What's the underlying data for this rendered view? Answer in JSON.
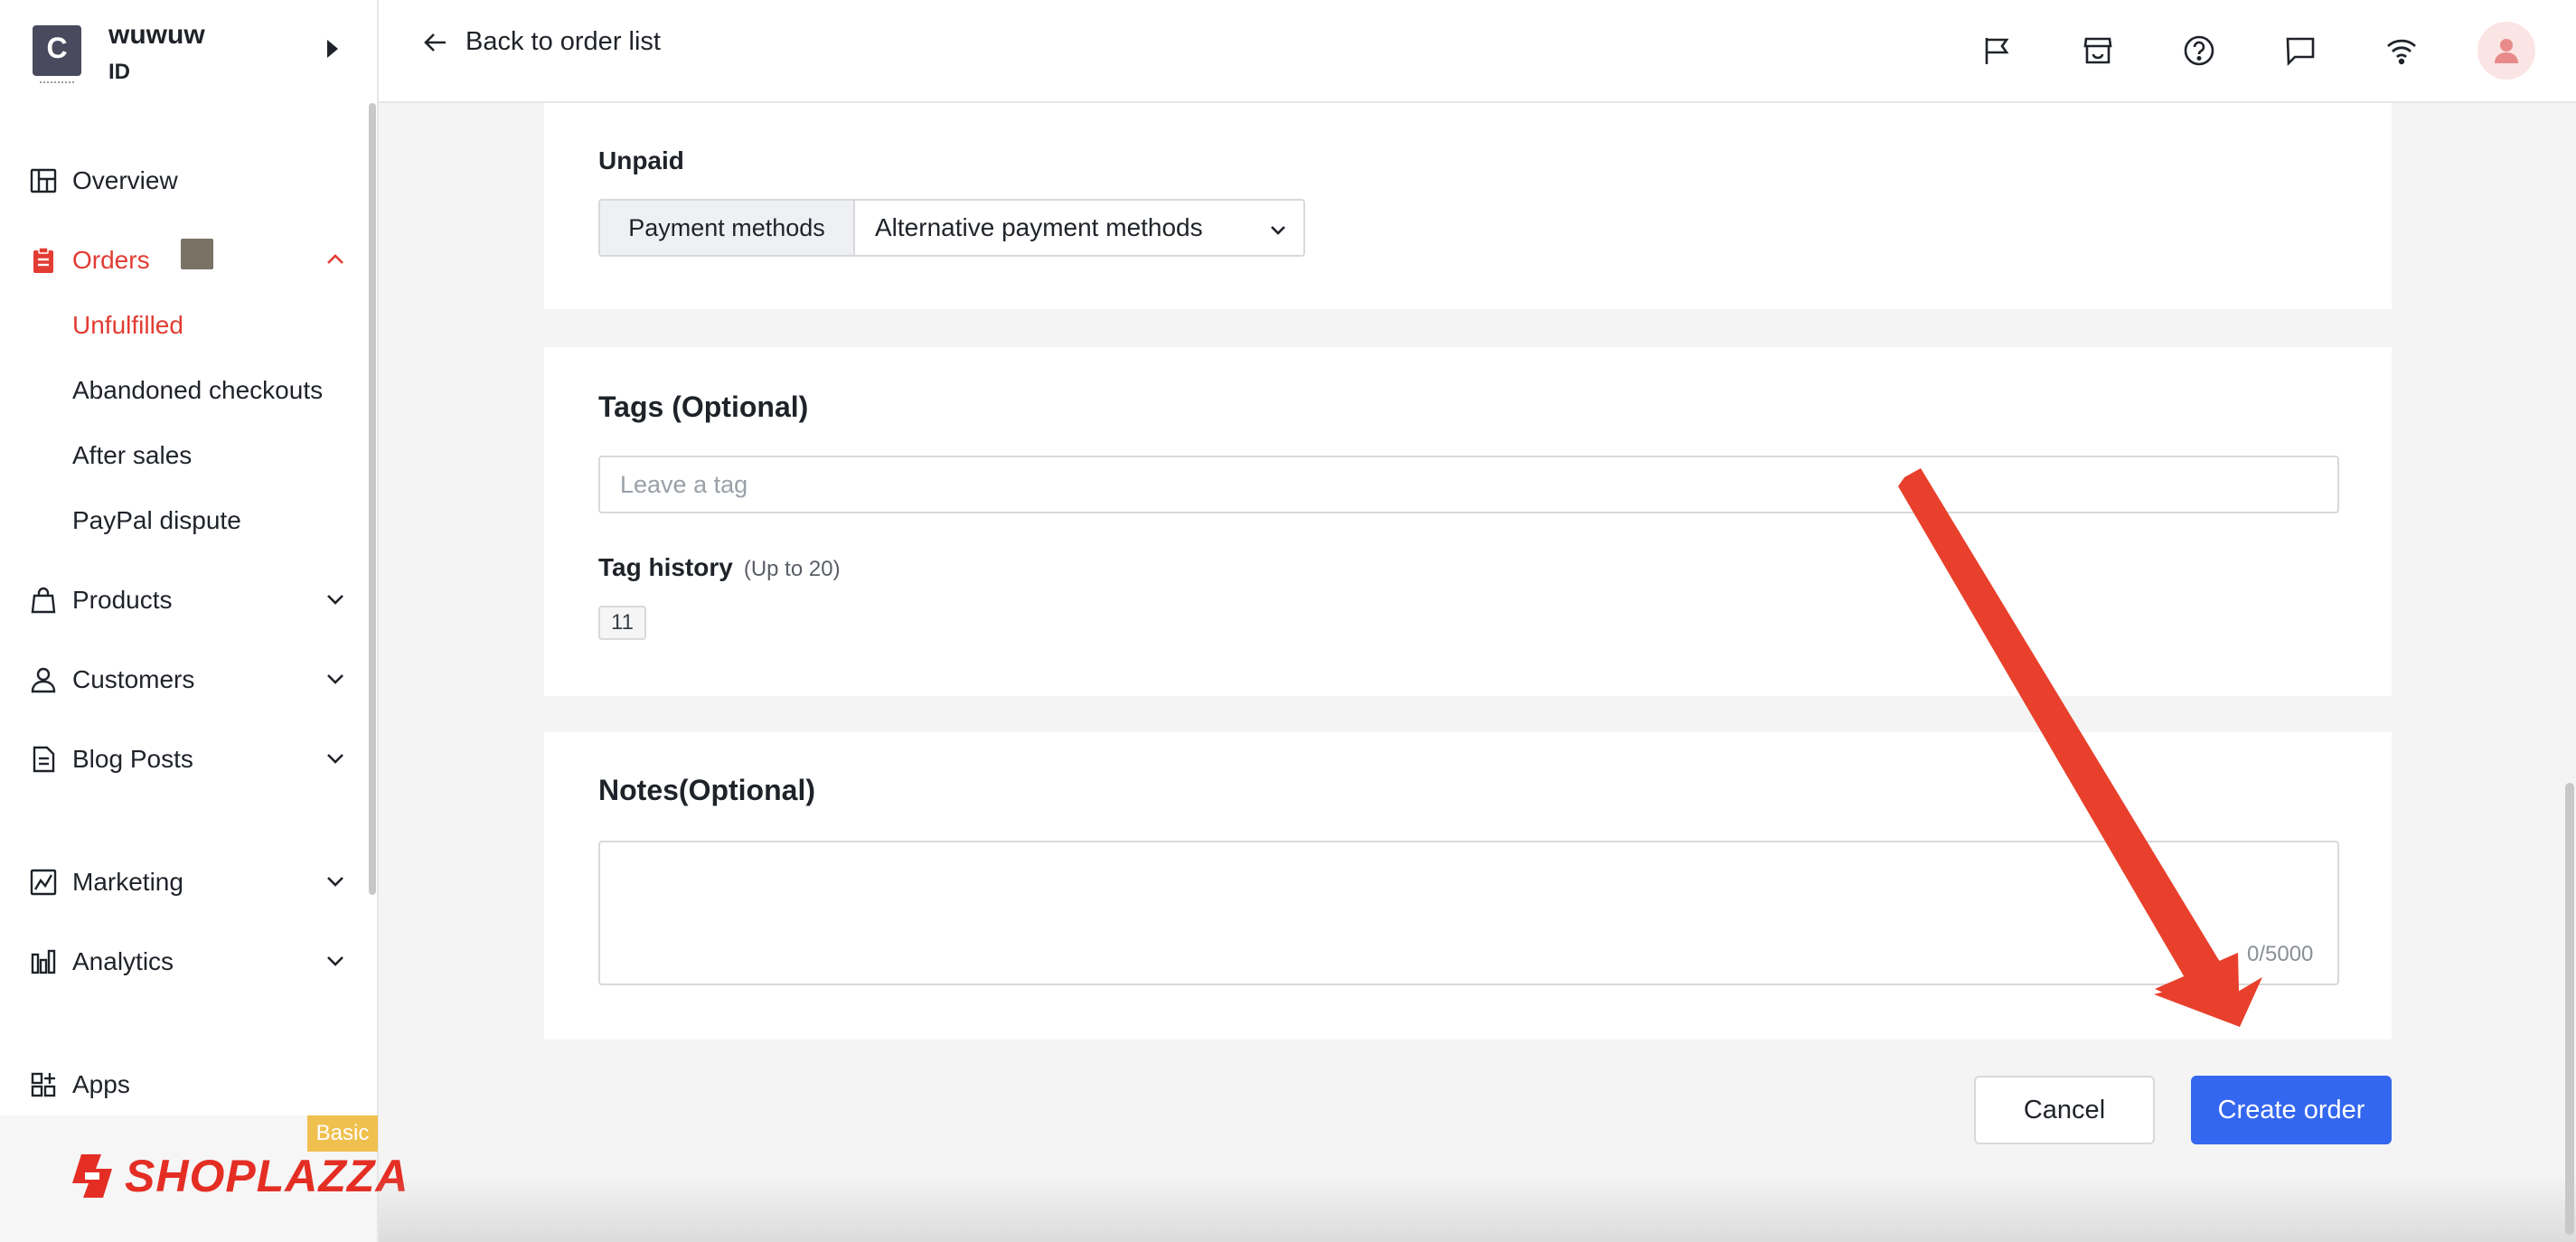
{
  "sidebar": {
    "store": {
      "logo_letter": "C",
      "name": "wuwuw",
      "id": "ID"
    },
    "items": [
      {
        "label": "Overview",
        "icon": "layout-icon"
      },
      {
        "label": "Orders",
        "icon": "clipboard-icon",
        "active": true,
        "expanded": true,
        "subitems": [
          {
            "label": "Unfulfilled",
            "active": true
          },
          {
            "label": "Abandoned checkouts"
          },
          {
            "label": "After sales"
          },
          {
            "label": "PayPal dispute"
          }
        ]
      },
      {
        "label": "Products",
        "icon": "bag-icon"
      },
      {
        "label": "Customers",
        "icon": "person-icon"
      },
      {
        "label": "Blog Posts",
        "icon": "document-icon"
      },
      {
        "label": "Marketing",
        "icon": "marketing-icon"
      },
      {
        "label": "Analytics",
        "icon": "bar-chart-icon"
      },
      {
        "label": "Apps",
        "icon": "apps-grid-icon"
      }
    ],
    "plan_badge": "Basic",
    "brand": "SHOPLAZZA"
  },
  "header": {
    "back_label": "Back to order list",
    "icons": [
      "flag-icon",
      "store-icon",
      "help-icon",
      "chat-icon",
      "wifi-icon",
      "avatar-icon"
    ]
  },
  "payment": {
    "status": "Unpaid",
    "addon_label": "Payment methods",
    "selected": "Alternative payment methods"
  },
  "tags": {
    "title": "Tags (Optional)",
    "placeholder": "Leave a tag",
    "history_title": "Tag history",
    "history_hint": "(Up to 20)",
    "history_items": [
      "11"
    ]
  },
  "notes": {
    "title": "Notes(Optional)",
    "value": "",
    "counter": "0/5000"
  },
  "actions": {
    "cancel_label": "Cancel",
    "create_label": "Create order"
  },
  "colors": {
    "accent_red": "#e23c33",
    "primary_blue": "#3467f0",
    "annotation_arrow": "#e8402c",
    "plan_badge": "#f0c04f"
  }
}
